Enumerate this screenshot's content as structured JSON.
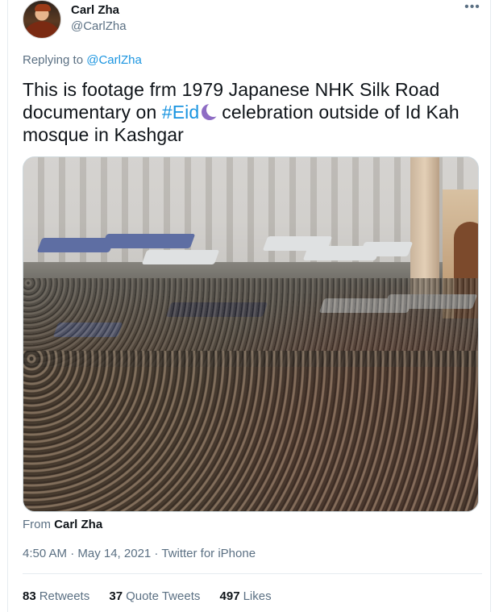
{
  "author": {
    "name": "Carl Zha",
    "handle": "@CarlZha"
  },
  "more_menu_icon": "more-dots-icon",
  "replying": {
    "prefix": "Replying to",
    "target": "@CarlZha"
  },
  "tweet": {
    "text_before": "This is footage frm 1979 Japanese NHK Silk Road documentary on",
    "hashtag": "#Eid",
    "emoji_icon": "crescent-moon-icon",
    "text_after": "celebration outside of Id Kah mosque in Kashgar"
  },
  "media": {
    "type": "video",
    "description_icon": "video-thumbnail"
  },
  "source": {
    "prefix": "From",
    "name": "Carl Zha"
  },
  "meta": {
    "timestamp": "4:50 AM · May 14, 2021 · Twitter for iPhone"
  },
  "stats": {
    "retweets": {
      "count": "83",
      "label": "Retweets"
    },
    "quote_tweets": {
      "count": "37",
      "label": "Quote Tweets"
    },
    "likes": {
      "count": "497",
      "label": "Likes"
    }
  },
  "colors": {
    "link": "#1b95e0",
    "muted": "#5b7083",
    "text": "#0f1419",
    "divider": "#e6ecf0"
  }
}
